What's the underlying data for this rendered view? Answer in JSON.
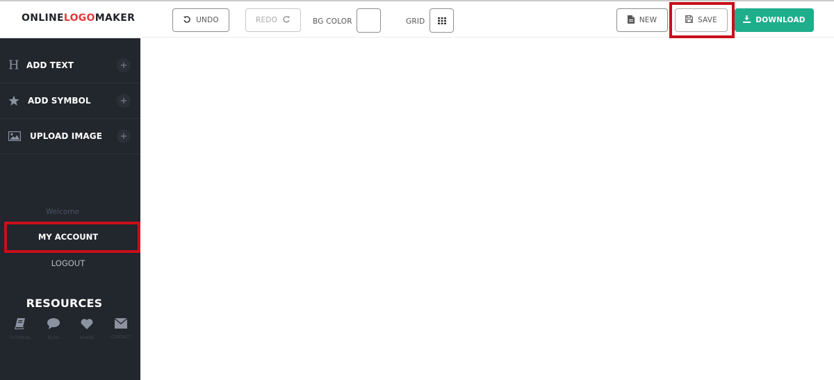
{
  "header": {
    "logo": {
      "part1": "ONLINE",
      "part2": "LOGO",
      "part3": "MAKER"
    },
    "undo_label": "UNDO",
    "redo_label": "REDO",
    "bg_color_label": "BG COLOR",
    "bg_color_value": "#ffffff",
    "grid_label": "GRID",
    "new_label": "NEW",
    "save_label": "SAVE",
    "download_label": "DOWNLOAD"
  },
  "sidebar": {
    "items": [
      {
        "label": "ADD TEXT",
        "icon": "heading-icon"
      },
      {
        "label": "ADD SYMBOL",
        "icon": "star-icon"
      },
      {
        "label": "UPLOAD IMAGE",
        "icon": "image-icon"
      }
    ],
    "welcome": "Welcome",
    "my_account": "MY ACCOUNT",
    "logout": "LOGOUT",
    "resources_title": "RESOURCES",
    "resources": [
      {
        "label": "TUTORIAL",
        "icon": "book-icon"
      },
      {
        "label": "BLOG",
        "icon": "speech-bubble-icon"
      },
      {
        "label": "SHARE",
        "icon": "heart-icon"
      },
      {
        "label": "CONTACT",
        "icon": "envelope-icon"
      }
    ]
  },
  "colors": {
    "accent": "#1fae8c",
    "logo_red": "#e03a3a",
    "sidebar_bg": "#22262d",
    "highlight": "#c8101a"
  }
}
